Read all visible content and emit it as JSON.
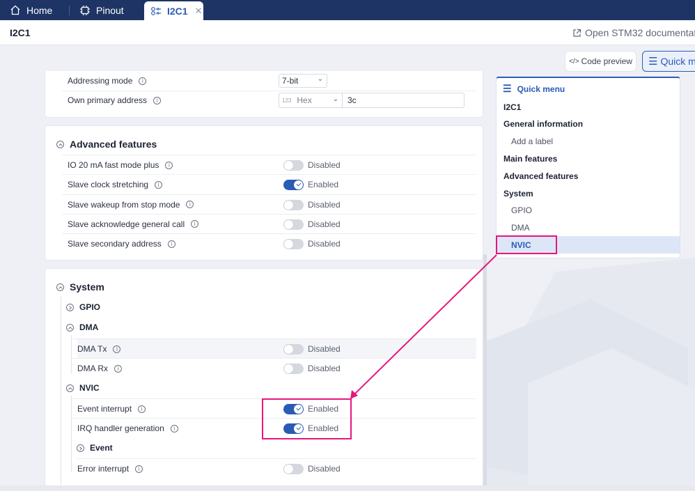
{
  "tabs": {
    "home": "Home",
    "pinout": "Pinout",
    "active": "I2C1",
    "close_glyph": "✕"
  },
  "header": {
    "title": "I2C1",
    "doc_link": "Open STM32 documentat"
  },
  "toolbar": {
    "code_preview": "Code preview",
    "quick_menu": "Quick m"
  },
  "main_features": {
    "addressing_mode_label": "Addressing mode",
    "addressing_mode_value": "7-bit",
    "own_address_label": "Own primary address",
    "own_address_format_prefix": "123",
    "own_address_format": "Hex",
    "own_address_value": "3c"
  },
  "advanced": {
    "title": "Advanced features",
    "rows": [
      {
        "label": "IO 20 mA fast mode plus",
        "state": "Disabled",
        "on": false
      },
      {
        "label": "Slave clock stretching",
        "state": "Enabled",
        "on": true
      },
      {
        "label": "Slave wakeup from stop mode",
        "state": "Disabled",
        "on": false
      },
      {
        "label": "Slave acknowledge general call",
        "state": "Disabled",
        "on": false
      },
      {
        "label": "Slave secondary address",
        "state": "Disabled",
        "on": false
      }
    ]
  },
  "system": {
    "title": "System",
    "gpio": "GPIO",
    "dma": {
      "title": "DMA",
      "rows": [
        {
          "label": "DMA Tx",
          "state": "Disabled",
          "on": false
        },
        {
          "label": "DMA Rx",
          "state": "Disabled",
          "on": false
        }
      ]
    },
    "nvic": {
      "title": "NVIC",
      "rows": [
        {
          "label": "Event interrupt",
          "state": "Enabled",
          "on": true
        },
        {
          "label": "IRQ handler generation",
          "state": "Enabled",
          "on": true
        }
      ],
      "event": "Event",
      "error_interrupt": {
        "label": "Error interrupt",
        "state": "Disabled",
        "on": false
      }
    }
  },
  "quick_menu": {
    "title": "Quick menu",
    "items": [
      {
        "label": "I2C1",
        "style": "bold"
      },
      {
        "label": "General information",
        "style": "bold"
      },
      {
        "label": "Add a label",
        "style": "sub"
      },
      {
        "label": "Main features",
        "style": "bold"
      },
      {
        "label": "Advanced features",
        "style": "bold"
      },
      {
        "label": "System",
        "style": "bold"
      },
      {
        "label": "GPIO",
        "style": "sub"
      },
      {
        "label": "DMA",
        "style": "sub"
      },
      {
        "label": "NVIC",
        "style": "active"
      }
    ]
  },
  "colors": {
    "accent": "#2a5bb5",
    "tabbar": "#1d3465",
    "annotation": "#e6157f"
  }
}
